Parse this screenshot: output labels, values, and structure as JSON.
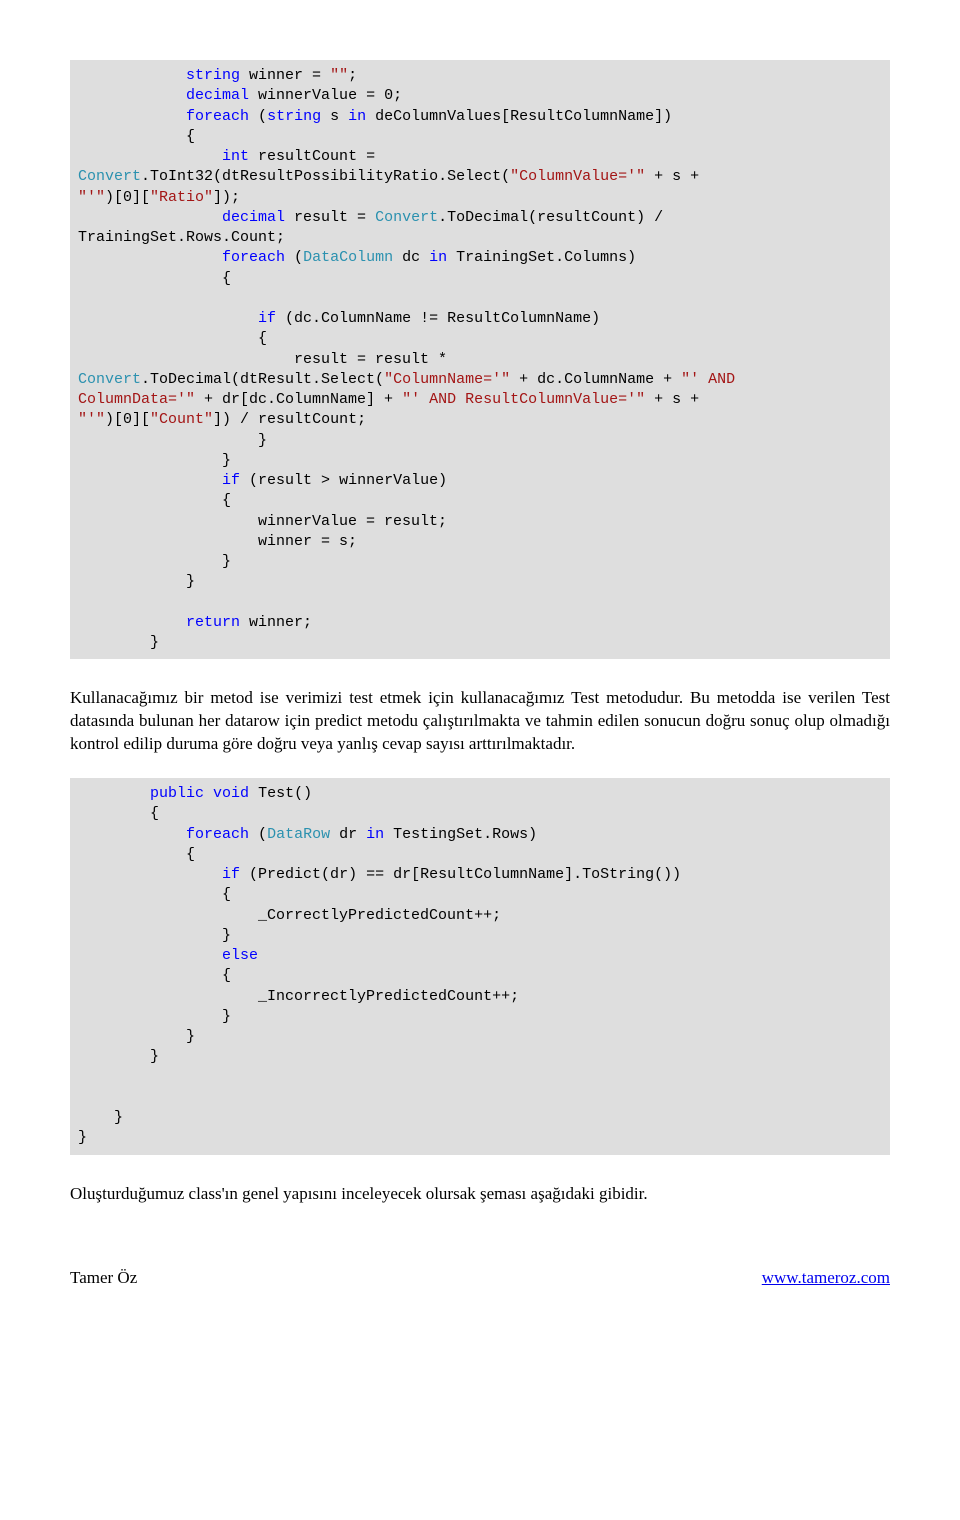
{
  "code1": {
    "l01a": "            ",
    "l01b": "string",
    "l01c": " winner = ",
    "l01d": "\"\"",
    "l01e": ";",
    "l02a": "            ",
    "l02b": "decimal",
    "l02c": " winnerValue = 0;",
    "l03a": "            ",
    "l03b": "foreach",
    "l03c": " (",
    "l03d": "string",
    "l03e": " s ",
    "l03f": "in",
    "l03g": " deColumnValues[ResultColumnName])",
    "l04": "            {",
    "l05a": "                ",
    "l05b": "int",
    "l05c": " resultCount = ",
    "l06a": "Convert",
    "l06b": ".ToInt32(dtResultPossibilityRatio.Select(",
    "l06c": "\"ColumnValue='\"",
    "l06d": " + s + ",
    "l07a": "\"'\"",
    "l07b": ")[0][",
    "l07c": "\"Ratio\"",
    "l07d": "]);",
    "l08a": "                ",
    "l08b": "decimal",
    "l08c": " result = ",
    "l08d": "Convert",
    "l08e": ".ToDecimal(resultCount) / ",
    "l09": "TrainingSet.Rows.Count;",
    "l10a": "                ",
    "l10b": "foreach",
    "l10c": " (",
    "l10d": "DataColumn",
    "l10e": " dc ",
    "l10f": "in",
    "l10g": " TrainingSet.Columns)",
    "l11": "                {",
    "blank1": "",
    "l12a": "                    ",
    "l12b": "if",
    "l12c": " (dc.ColumnName != ResultColumnName)",
    "l13": "                    {",
    "l14": "                        result = result * ",
    "l15a": "Convert",
    "l15b": ".ToDecimal(dtResult.Select(",
    "l15c": "\"ColumnName='\"",
    "l15d": " + dc.ColumnName + ",
    "l15e": "\"' AND ",
    "l16a": "ColumnData='\"",
    "l16b": " + dr[dc.ColumnName] + ",
    "l16c": "\"' AND ResultColumnValue='\"",
    "l16d": " + s + ",
    "l17a": "\"'\"",
    "l17b": ")[0][",
    "l17c": "\"Count\"",
    "l17d": "]) / resultCount;",
    "l18": "                    }",
    "l19": "                }",
    "l20a": "                ",
    "l20b": "if",
    "l20c": " (result > winnerValue)",
    "l21": "                {",
    "l22": "                    winnerValue = result;",
    "l23": "                    winner = s;",
    "l24": "                }",
    "l25": "            }",
    "blank2": "",
    "l26a": "            ",
    "l26b": "return",
    "l26c": " winner;",
    "l27": "        }"
  },
  "para1": "Kullanacağımız bir metod ise verimizi test etmek için kullanacağımız Test metodudur. Bu metodda ise verilen Test datasında bulunan her datarow için predict metodu çalıştırılmakta ve tahmin edilen sonucun doğru sonuç olup olmadığı kontrol edilip duruma göre doğru veya yanlış cevap sayısı arttırılmaktadır.",
  "code2": {
    "l01a": "        ",
    "l01b": "public",
    "l01c": " ",
    "l01d": "void",
    "l01e": " Test()",
    "l02": "        {",
    "l03a": "            ",
    "l03b": "foreach",
    "l03c": " (",
    "l03d": "DataRow",
    "l03e": " dr ",
    "l03f": "in",
    "l03g": " TestingSet.Rows)",
    "l04": "            {",
    "l05a": "                ",
    "l05b": "if",
    "l05c": " (Predict(dr) == dr[ResultColumnName].ToString())",
    "l06": "                {",
    "l07": "                    _CorrectlyPredictedCount++;",
    "l08": "                }",
    "l09a": "                ",
    "l09b": "else",
    "l10": "                {",
    "l11": "                    _IncorrectlyPredictedCount++;",
    "l12": "                }",
    "l13": "            }",
    "l14": "        }",
    "blank1": "",
    "blank2": "",
    "l15": "    }",
    "l16": "}"
  },
  "para2": "Oluşturduğumuz class'ın genel yapısını inceleyecek olursak şeması aşağıdaki gibidir.",
  "footer": {
    "left": "Tamer Öz",
    "right": "www.tameroz.com"
  }
}
